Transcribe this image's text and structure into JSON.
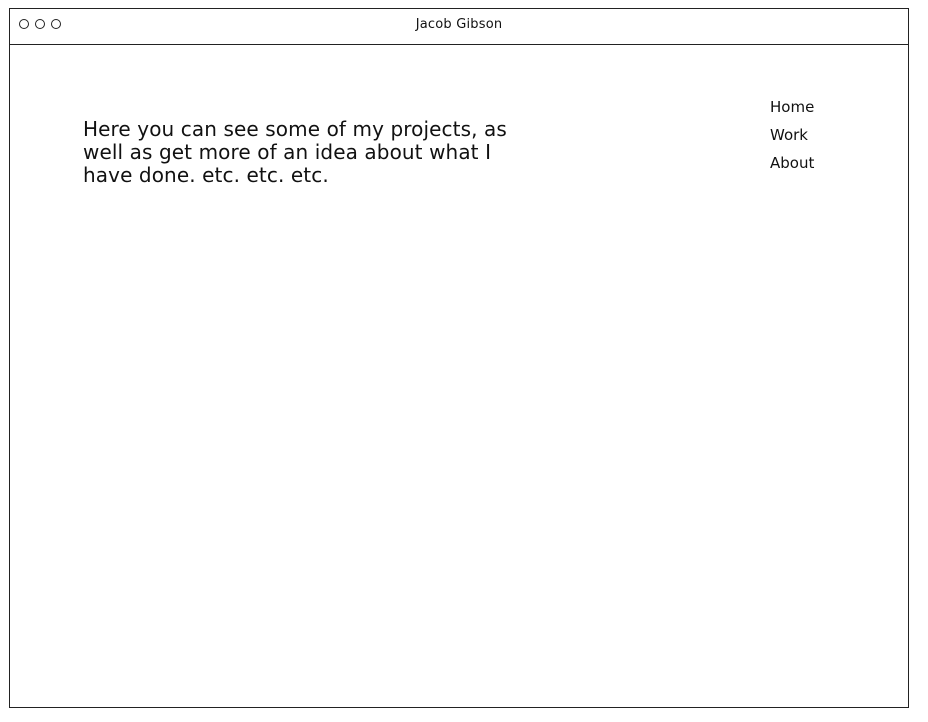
{
  "window": {
    "title": "Jacob Gibson"
  },
  "main": {
    "intro_text": "Here you can see some of my projects, as well as get more of an idea about what I have done. etc. etc. etc."
  },
  "nav": {
    "items": [
      {
        "label": "Home"
      },
      {
        "label": "Work"
      },
      {
        "label": "About"
      }
    ]
  }
}
